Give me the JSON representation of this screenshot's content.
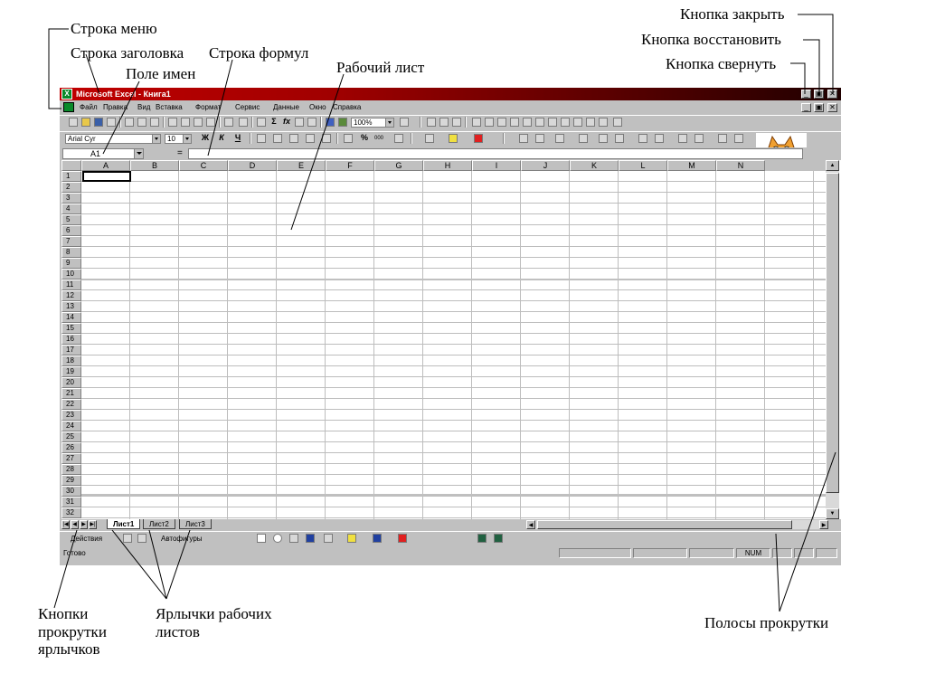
{
  "annotations": {
    "menu_bar": "Строка меню",
    "title_bar": "Строка заголовка",
    "name_box": "Поле имен",
    "formula_bar": "Строка формул",
    "worksheet": "Рабочий лист",
    "close_button": "Кнопка закрыть",
    "restore_button": "Кнопка восстановить",
    "minimize_button": "Кнопка свернуть",
    "tab_scroll_buttons_l1": "Кнопки",
    "tab_scroll_buttons_l2": "прокрутки",
    "tab_scroll_buttons_l3": "ярлычков",
    "sheet_tabs_l1": "Ярлычки рабочих",
    "sheet_tabs_l2": "листов",
    "scrollbars": "Полосы прокрутки"
  },
  "window": {
    "title": "Microsoft Excel - Книга1",
    "app_icon": "excel-icon",
    "min_glyph": "_",
    "restore_glyph": "▣",
    "close_glyph": "✕"
  },
  "menu": [
    "Файл",
    "Правка",
    "Вид",
    "Вставка",
    "Формат",
    "Сервис",
    "Данные",
    "Окно",
    "Справка"
  ],
  "toolbar": {
    "zoom": "100%",
    "font": "Arial Cyr",
    "size": "10",
    "bold": "Ж",
    "italic": "К",
    "underline": "Ч",
    "sigma": "Σ",
    "fx": "fx",
    "percent": "%",
    "thousands": "000"
  },
  "formula_bar": {
    "name_box": "A1",
    "equals": "=",
    "value": ""
  },
  "columns": [
    "A",
    "B",
    "C",
    "D",
    "E",
    "F",
    "G",
    "H",
    "I",
    "J",
    "K",
    "L",
    "M",
    "N"
  ],
  "rows": [
    "1",
    "2",
    "3",
    "4",
    "5",
    "6",
    "7",
    "8",
    "9",
    "10",
    "11",
    "12",
    "13",
    "14",
    "15",
    "16",
    "17",
    "18",
    "19",
    "20",
    "21",
    "22",
    "23",
    "24",
    "25",
    "26",
    "27",
    "28",
    "29",
    "30",
    "31",
    "32"
  ],
  "sheet_tabs": [
    "Лист1",
    "Лист2",
    "Лист3"
  ],
  "drawing_toolbar": {
    "actions": "Действия",
    "autoshapes": "Автофигуры"
  },
  "status": {
    "text": "Готово",
    "num": "NUM"
  },
  "colors": {
    "title_gradient_start": "#c00000",
    "title_gradient_end": "#200000",
    "chrome": "#c0c0c0",
    "excel_green": "#0a8a2a"
  }
}
